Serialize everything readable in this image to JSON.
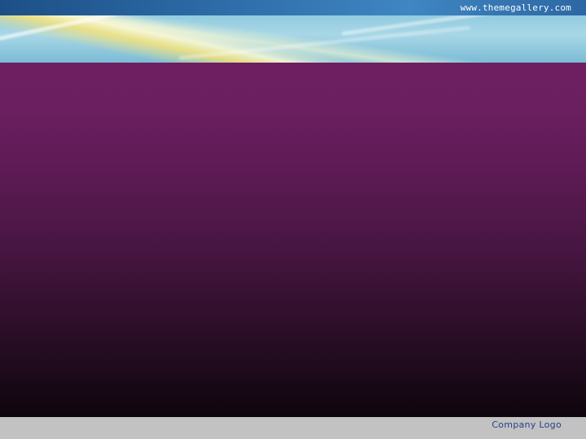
{
  "header": {
    "website": "www.themegallery.com"
  },
  "footer": {
    "company_logo": "Company Logo"
  },
  "colors": {
    "top_strip": "#2c6aa5",
    "header_band": "#a8d7e6",
    "content_top": "#6e1f62",
    "content_bottom": "#0f050d",
    "footer": "#c2c2c2",
    "logo_text": "#28408b"
  }
}
